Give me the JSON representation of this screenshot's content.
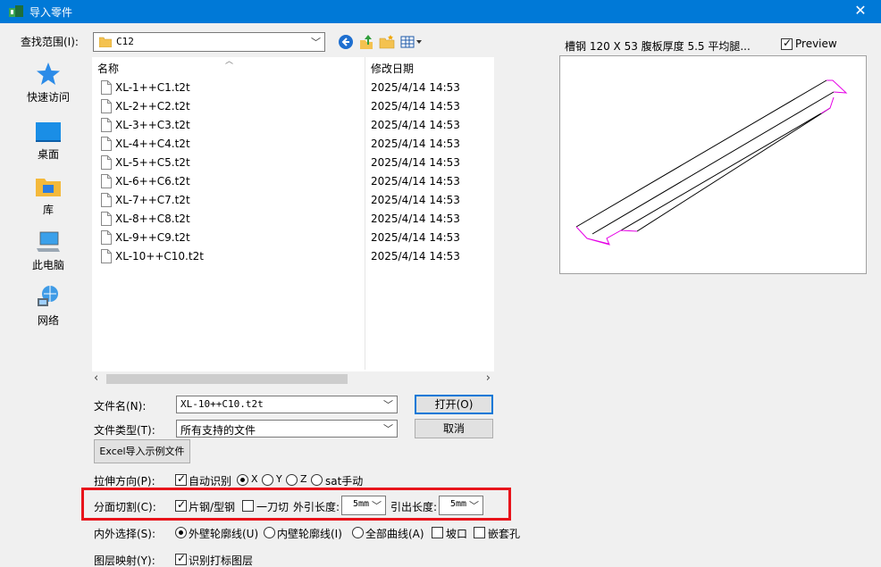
{
  "window": {
    "title": "导入零件",
    "close_glyph": "✕"
  },
  "lookin": {
    "label": "查找范围(I):",
    "value": "C12"
  },
  "places": [
    {
      "label": "快速访问",
      "icon": "star-icon"
    },
    {
      "label": "桌面",
      "icon": "desktop-icon"
    },
    {
      "label": "库",
      "icon": "library-icon"
    },
    {
      "label": "此电脑",
      "icon": "computer-icon"
    },
    {
      "label": "网络",
      "icon": "network-icon"
    }
  ],
  "filelist": {
    "headers": {
      "name": "名称",
      "date": "修改日期"
    },
    "files": [
      {
        "name": "XL-1++C1.t2t",
        "date": "2025/4/14 14:53"
      },
      {
        "name": "XL-2++C2.t2t",
        "date": "2025/4/14 14:53"
      },
      {
        "name": "XL-3++C3.t2t",
        "date": "2025/4/14 14:53"
      },
      {
        "name": "XL-4++C4.t2t",
        "date": "2025/4/14 14:53"
      },
      {
        "name": "XL-5++C5.t2t",
        "date": "2025/4/14 14:53"
      },
      {
        "name": "XL-6++C6.t2t",
        "date": "2025/4/14 14:53"
      },
      {
        "name": "XL-7++C7.t2t",
        "date": "2025/4/14 14:53"
      },
      {
        "name": "XL-8++C8.t2t",
        "date": "2025/4/14 14:53"
      },
      {
        "name": "XL-9++C9.t2t",
        "date": "2025/4/14 14:53"
      },
      {
        "name": "XL-10++C10.t2t",
        "date": "2025/4/14 14:53"
      }
    ]
  },
  "filename": {
    "label": "文件名(N):",
    "value": "XL-10++C10.t2t"
  },
  "filetype": {
    "label": "文件类型(T):",
    "value": "所有支持的文件"
  },
  "buttons": {
    "open": "打开(O)",
    "cancel": "取消",
    "excel": "Excel导入示例文件"
  },
  "options": {
    "stretch": {
      "label": "拉伸方向(P):",
      "auto": "自动识别",
      "x": "X",
      "y": "Y",
      "z": "Z",
      "sat": "sat手动"
    },
    "cut": {
      "label": "分面切割(C):",
      "plate": "片钢/型钢",
      "onecut": "一刀切",
      "ext_label": "外引长度:",
      "ext_value": "5mm",
      "lead_label": "引出长度:",
      "lead_value": "5mm"
    },
    "contour": {
      "label": "内外选择(S):",
      "outer": "外壁轮廓线(U)",
      "inner": "内壁轮廓线(I)",
      "all": "全部曲线(A)",
      "slope": "坡口",
      "nest": "嵌套孔"
    },
    "layer": {
      "label": "图层映射(Y):",
      "recognize": "识别打标图层"
    }
  },
  "preview": {
    "title": "槽钢 120 X 53 腹板厚度 5.5 平均腿...",
    "checkbox_label": "Preview",
    "colors": {
      "outline": "#000000",
      "end": "#e600e6"
    }
  }
}
